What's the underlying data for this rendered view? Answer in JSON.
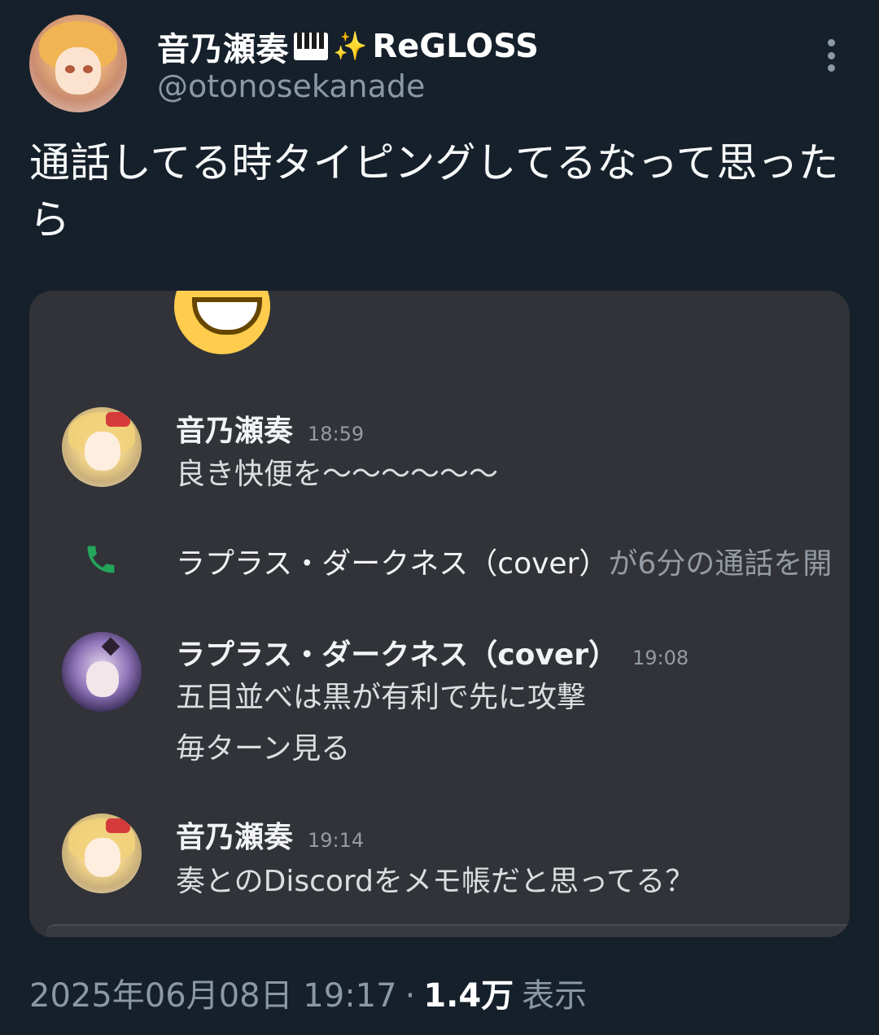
{
  "author": {
    "display_name": "音乃瀬奏",
    "icons": [
      "piano-icon",
      "sparkle-icon"
    ],
    "group": "ReGLOSS",
    "handle": "@otonosekanade"
  },
  "tweet": {
    "text": "通話してる時タイピングしてるなって思ったら"
  },
  "media": {
    "type": "discord-screenshot",
    "messages": [
      {
        "name": "音乃瀬奏",
        "time": "18:59",
        "lines": [
          "良き快便を〜〜〜〜〜〜"
        ]
      },
      {
        "call_name": "ラプラス・ダークネス（cover）",
        "call_text": "が6分の通話を開"
      },
      {
        "name": "ラプラス・ダークネス（cover）",
        "time": "19:08",
        "lines": [
          "五目並べは黒が有利で先に攻撃",
          "毎ターン見る"
        ]
      },
      {
        "name": "音乃瀬奏",
        "time": "19:14",
        "lines": [
          "奏とのDiscordをメモ帳だと思ってる？"
        ]
      }
    ]
  },
  "footer": {
    "timestamp": "2025年06月08日 19:17",
    "separator": "·",
    "views_count": "1.4万",
    "views_label": "表示"
  },
  "colors": {
    "background": "#15202b",
    "discord_bg": "#313338",
    "call_green": "#23a55a"
  }
}
